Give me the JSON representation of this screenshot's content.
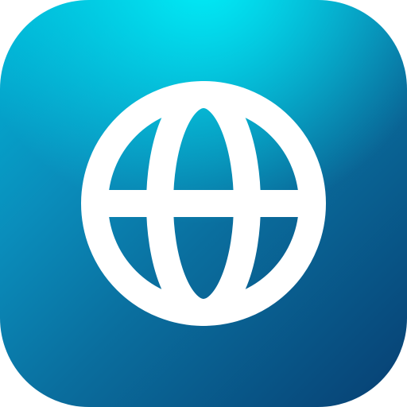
{
  "app_icon": {
    "icon": "globe-icon",
    "colors": {
      "gradient_top": "#00eef8",
      "gradient_mid": "#0a8dbb",
      "gradient_bottom": "#073f72",
      "glyph": "#ffffff"
    }
  }
}
